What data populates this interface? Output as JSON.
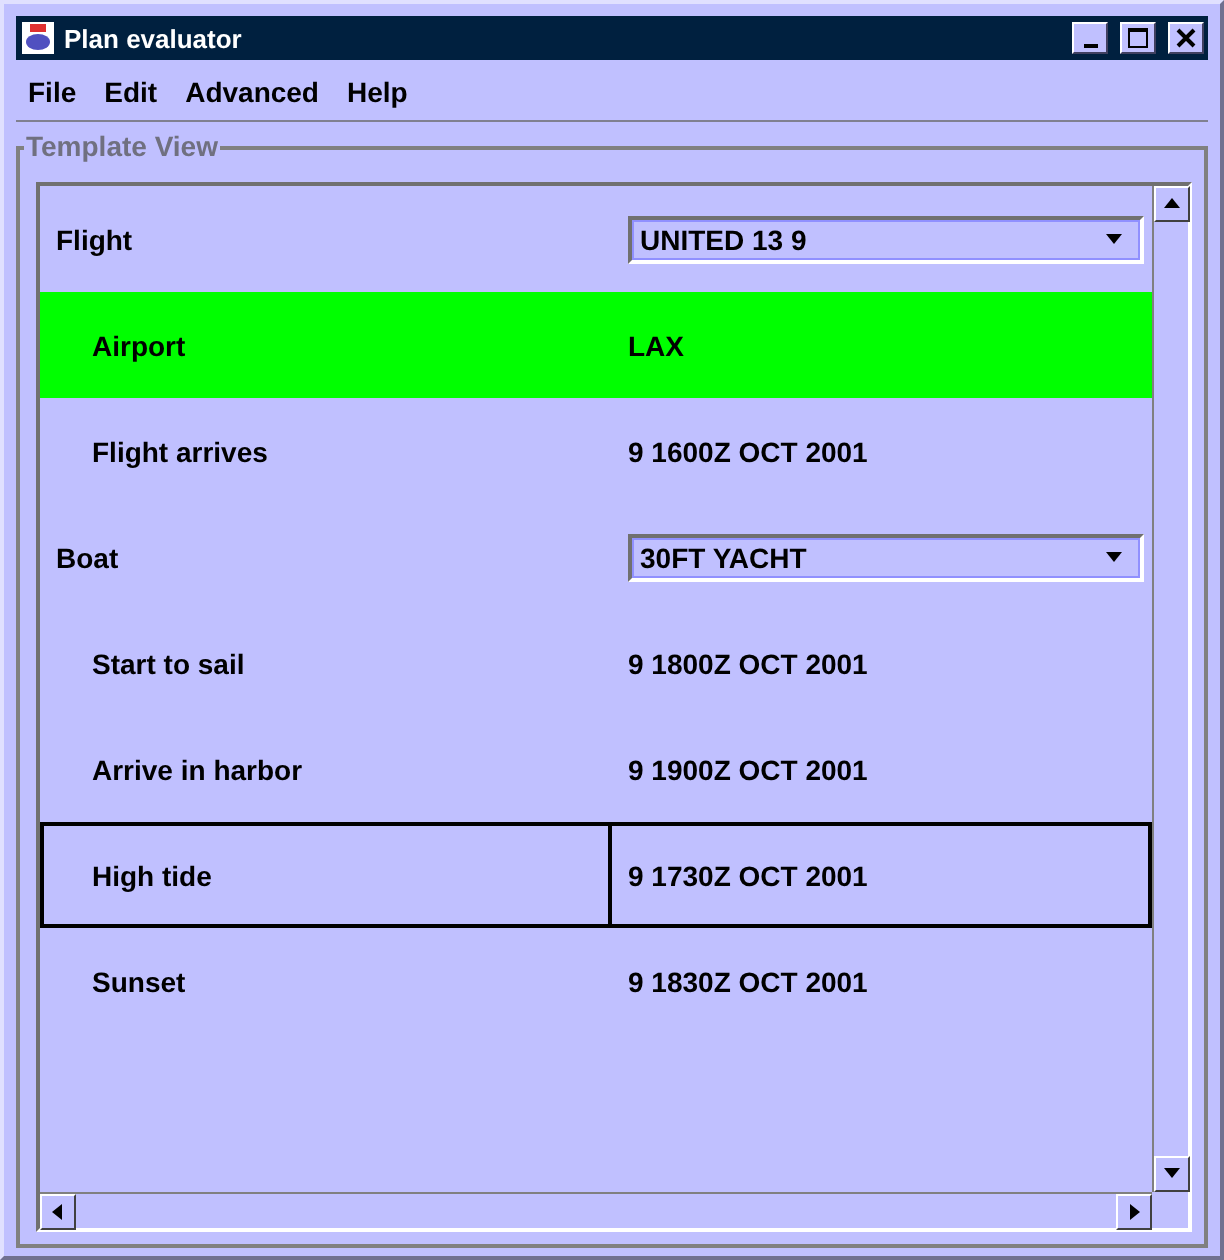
{
  "window": {
    "title": "Plan evaluator"
  },
  "menu": [
    "File",
    "Edit",
    "Advanced",
    "Help"
  ],
  "panel": {
    "title": "Template View"
  },
  "rows": [
    {
      "kind": "group",
      "label": "Flight",
      "value": "UNITED 13 9",
      "highlighted": false,
      "selected": false
    },
    {
      "kind": "item",
      "label": "Airport",
      "value": "LAX",
      "highlighted": true,
      "selected": false
    },
    {
      "kind": "item",
      "label": "Flight arrives",
      "value": "9 1600Z OCT 2001",
      "highlighted": false,
      "selected": false
    },
    {
      "kind": "group",
      "label": "Boat",
      "value": "30FT YACHT",
      "highlighted": false,
      "selected": false
    },
    {
      "kind": "item",
      "label": "Start to sail",
      "value": "9 1800Z OCT 2001",
      "highlighted": false,
      "selected": false
    },
    {
      "kind": "item",
      "label": "Arrive in harbor",
      "value": "9 1900Z OCT 2001",
      "highlighted": false,
      "selected": false
    },
    {
      "kind": "item",
      "label": "High tide",
      "value": "9 1730Z OCT 2001",
      "highlighted": false,
      "selected": true
    },
    {
      "kind": "item",
      "label": "Sunset",
      "value": "9 1830Z OCT 2001",
      "highlighted": false,
      "selected": false
    }
  ]
}
